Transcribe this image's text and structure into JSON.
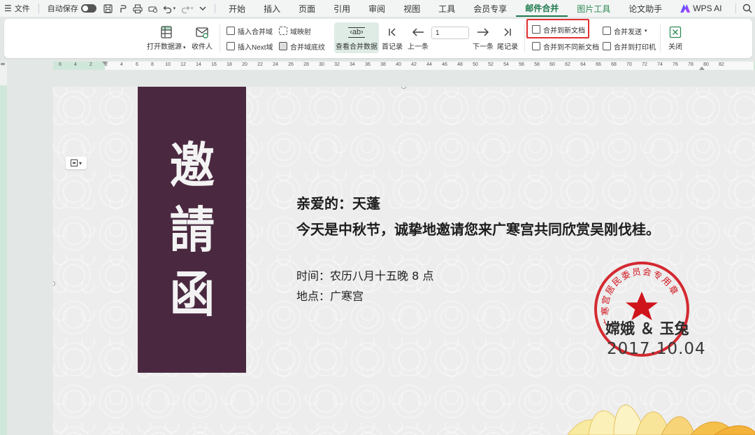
{
  "menubar": {
    "file_label": "文件",
    "autosave_label": "自动保存",
    "tabs": [
      "开始",
      "插入",
      "页面",
      "引用",
      "审阅",
      "视图",
      "工具",
      "会员专享",
      "邮件合并",
      "图片工具",
      "论文助手"
    ],
    "active_tab": "邮件合并",
    "wps_ai_label": "WPS AI"
  },
  "ribbon": {
    "open_datasource": "打开数据源",
    "recipients": "收件人",
    "insert_merge_field": "插入合并域",
    "insert_next_field": "插入Next域",
    "field_mapping": "域映射",
    "merge_field_shading": "合并域底纹",
    "view_merged_data": "查看合并数据",
    "view_icon_text": "‹ab›",
    "first_record": "首记录",
    "previous": "上一条",
    "record_number": "1",
    "next": "下一条",
    "last_record": "尾记录",
    "merge_to_new_doc": "合并到新文档",
    "merge_to_separate_docs": "合并到不同新文档",
    "merge_send": "合并发送",
    "merge_to_printer": "合并到打印机",
    "close": "关闭"
  },
  "ruler": {
    "ticks": [
      "6",
      "4",
      "2",
      "2",
      "4",
      "6",
      "8",
      "10",
      "12",
      "14",
      "16",
      "18",
      "20",
      "22",
      "24",
      "26",
      "28",
      "30",
      "32",
      "34",
      "36",
      "38",
      "40",
      "42",
      "44",
      "46",
      "48",
      "50",
      "52",
      "54",
      "56",
      "58",
      "60",
      "62",
      "64",
      "66",
      "68",
      "70",
      "72",
      "74",
      "76",
      "78",
      "80",
      "82"
    ]
  },
  "document": {
    "banner_chars": [
      "邀",
      "請",
      "函"
    ],
    "greeting": "亲爱的：天蓬",
    "message": "今天是中秋节，诚挚地邀请您来广寒宫共同欣赏吴刚伐桂。",
    "time_line": "时间：农历八月十五晚 8 点",
    "place_line": "地点：广寒宫",
    "signature": "嫦娥 ＆ 玉兔",
    "date": "2017.10.04",
    "seal_text": "广寒宫居民委员会专用章"
  },
  "colors": {
    "accent": "#1e7a4e",
    "banner": "#4a2940",
    "seal_red": "#d0141c",
    "highlight": "#e03030"
  }
}
